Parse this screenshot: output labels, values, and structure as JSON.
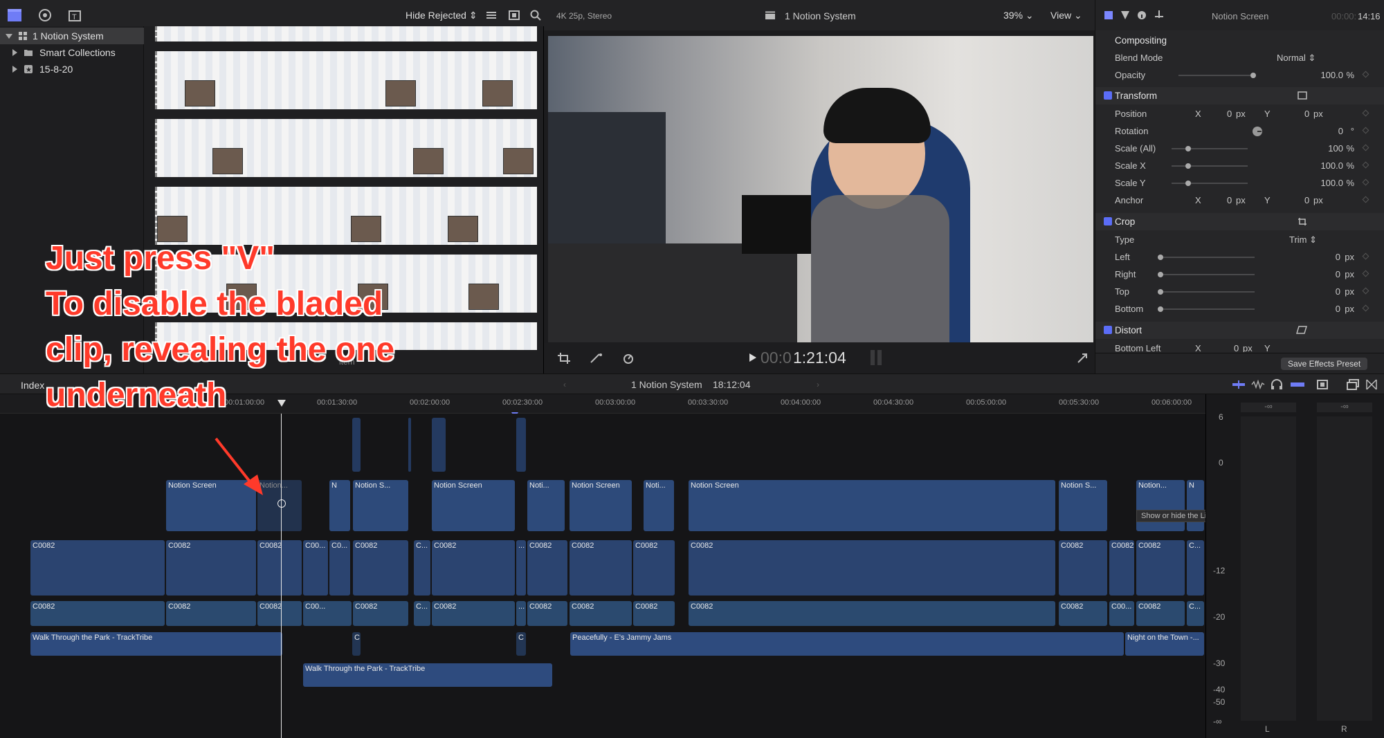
{
  "topbar": {
    "hide_rejected": "Hide Rejected ⇕",
    "viewer_format": "4K 25p, Stereo",
    "viewer_title": "1 Notion System",
    "zoom": "39% ⌄",
    "view": "View ⌄",
    "inspector_title": "Notion Screen",
    "inspector_time_dim": "00:00:",
    "inspector_time": "14:16"
  },
  "libraries": {
    "items": [
      {
        "label": "1 Notion System"
      },
      {
        "label": "Smart Collections"
      },
      {
        "label": "15-8-20"
      }
    ]
  },
  "browser": {
    "footer": "item"
  },
  "viewer": {
    "timecode_dim": "00:0",
    "timecode": "1:21:04"
  },
  "inspector": {
    "compositing": "Compositing",
    "blend_mode_label": "Blend Mode",
    "blend_mode_value": "Normal ⇕",
    "opacity_label": "Opacity",
    "opacity_value": "100.0",
    "opacity_unit": "%",
    "transform": "Transform",
    "position_label": "Position",
    "position_x": "0",
    "position_y": "0",
    "rotation_label": "Rotation",
    "rotation_value": "0",
    "rotation_unit": "°",
    "scale_all_label": "Scale (All)",
    "scale_all_value": "100",
    "scale_x_label": "Scale X",
    "scale_x_value": "100.0",
    "scale_y_label": "Scale Y",
    "scale_y_value": "100.0",
    "anchor_label": "Anchor",
    "anchor_x": "0",
    "anchor_y": "0",
    "crop": "Crop",
    "type_label": "Type",
    "type_value": "Trim ⇕",
    "left_label": "Left",
    "left_value": "0",
    "right_label": "Right",
    "right_value": "0",
    "top_label": "Top",
    "top_value": "0",
    "bottom_label": "Bottom",
    "bottom_value": "0",
    "distort": "Distort",
    "bottom_left_label": "Bottom Left",
    "bottom_left_x": "0",
    "x": "X",
    "y": "Y",
    "px": "px",
    "percent": "%",
    "save_preset": "Save Effects Preset"
  },
  "timeline_bar": {
    "index": "Index",
    "project": "1 Notion System",
    "duration": "18:12:04"
  },
  "ruler": [
    "00:01:00:00",
    "00:01:30:00",
    "00:02:00:00",
    "00:02:30:00",
    "00:03:00:00",
    "00:03:30:00",
    "00:04:00:00",
    "00:04:30:00",
    "00:05:00:00",
    "00:05:30:00",
    "00:06:00:00"
  ],
  "clips": {
    "titles": [
      "Notion Screen",
      "Notion...",
      "N",
      "Notion S...",
      "Notion Screen",
      "Noti...",
      "Notion Screen",
      "Noti...",
      "Notion Screen",
      "Notion S...",
      "Notion...",
      "N"
    ],
    "video": [
      "C0082",
      "C0082",
      "C0082",
      "C00...",
      "C0...",
      "C0082",
      "C...",
      "C0082",
      "...",
      "C0082",
      "C0082",
      "C0082",
      "C0082",
      "C0082",
      "C0082",
      "C0082",
      "C..."
    ],
    "audio": [
      "C0082",
      "C0082",
      "C0082",
      "C00...",
      "C0082",
      "C...",
      "C0082",
      "...",
      "C0082",
      "C0082",
      "C0082",
      "C0082",
      "C0082",
      "C00...",
      "C0082",
      "C..."
    ],
    "music1": "Walk Through the Park - TrackTribe",
    "music2": "Walk Through the Park - TrackTribe",
    "music3": "Peacefully - E's Jammy Jams",
    "music4": "Night on the Town -...",
    "small_c": "C"
  },
  "tooltip": "Show or hide the Libraries sidebar",
  "meters": {
    "scale": [
      "6",
      "0",
      "-12",
      "-20",
      "-30",
      "-40",
      "-50",
      "-∞"
    ],
    "peak_l": "-∞",
    "peak_r": "-∞",
    "label_l": "L",
    "label_r": "R"
  },
  "annotation": {
    "line1": "Just press \"V\"",
    "line2": "To disable the bladed",
    "line3": "clip, revealing the one",
    "line4": "underneath"
  },
  "colors": {
    "accent": "#5b6df7",
    "annotation": "#ff3a2a"
  }
}
